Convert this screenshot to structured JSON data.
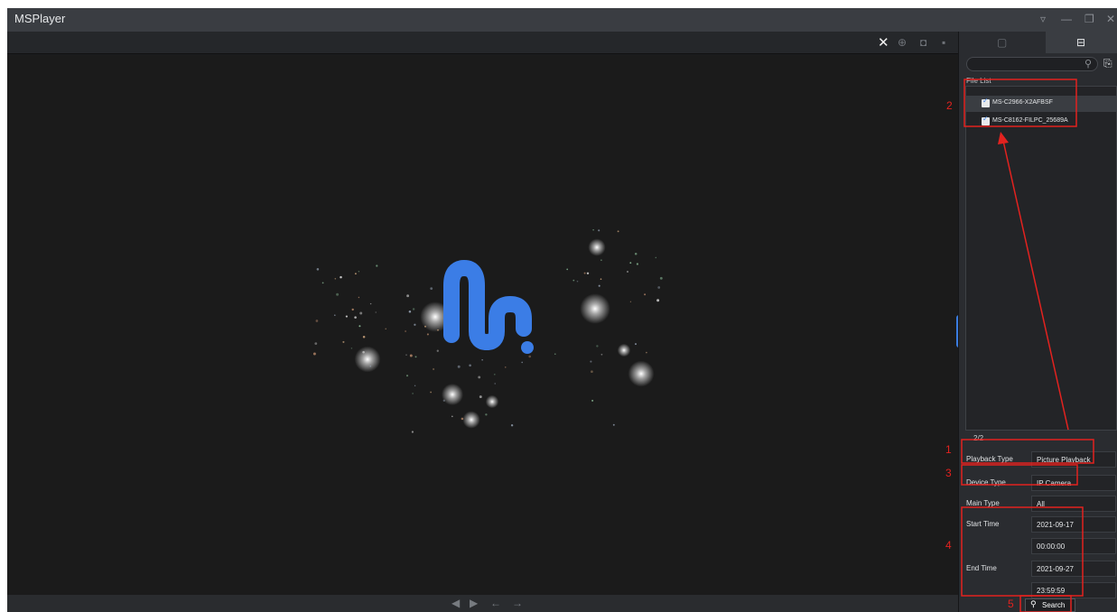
{
  "app": {
    "title": "MSPlayer"
  },
  "window_controls": [
    {
      "name": "dropdown-icon",
      "glyph": "▿"
    },
    {
      "name": "minimize-icon",
      "glyph": "—"
    },
    {
      "name": "restore-icon",
      "glyph": "❐"
    },
    {
      "name": "close-window-icon",
      "glyph": "✕"
    }
  ],
  "video_toolbar": [
    {
      "name": "close-video-icon",
      "glyph": "✕"
    },
    {
      "name": "zoom-icon",
      "glyph": "⊕"
    },
    {
      "name": "snapshot-icon",
      "glyph": "◘"
    },
    {
      "name": "record-icon",
      "glyph": "▪"
    }
  ],
  "bottom_nav": [
    {
      "name": "prev-frame-icon",
      "glyph": "◀"
    },
    {
      "name": "next-frame-icon",
      "glyph": "▶"
    },
    {
      "name": "back-arrow-icon",
      "glyph": "←"
    },
    {
      "name": "forward-arrow-icon",
      "glyph": "→"
    }
  ],
  "sidebar": {
    "tabs": [
      {
        "name": "tab-files",
        "icon": "file-icon",
        "glyph": "▢",
        "active": false
      },
      {
        "name": "tab-devices",
        "icon": "device-icon",
        "glyph": "⊟",
        "active": true
      }
    ],
    "search": {
      "placeholder": "",
      "icon": "search-icon",
      "glyph": "⚲"
    },
    "export_icon": {
      "name": "export-icon",
      "glyph": "⎘"
    },
    "file_list_label": "File List",
    "files": [
      {
        "name": "MS-C2966-X2AFBSF",
        "checked": true,
        "selected": true
      },
      {
        "name": "MS-C8162-FILPC_25689A",
        "checked": true,
        "selected": false
      }
    ],
    "count": "2/2",
    "form": {
      "playback_type": {
        "label": "Playback Type",
        "value": "Picture Playback"
      },
      "device_type": {
        "label": "Device Type",
        "value": "IP Camera"
      },
      "main_type": {
        "label": "Main Type",
        "value": "All"
      },
      "start_time": {
        "label": "Start Time",
        "date": "2021-09-17",
        "time": "00:00:00"
      },
      "end_time": {
        "label": "End Time",
        "date": "2021-09-27",
        "time": "23:59:59"
      }
    },
    "search_button": {
      "label": "Search",
      "glyph": "🔍"
    }
  },
  "annotations": [
    {
      "number": "1"
    },
    {
      "number": "2"
    },
    {
      "number": "3"
    },
    {
      "number": "4"
    },
    {
      "number": "5"
    }
  ],
  "colors": {
    "annotation": "#e3221f",
    "accent": "#3a7ce0",
    "logo": "#3b7de6"
  }
}
